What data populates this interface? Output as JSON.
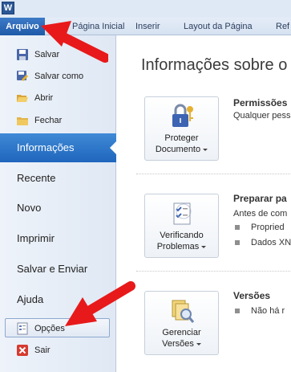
{
  "app": {
    "icon_letter": "W"
  },
  "ribbon": {
    "file_tab": "Arquivo",
    "tabs": [
      "Página Inicial",
      "Inserir",
      "Layout da Página",
      "Ref"
    ]
  },
  "backstage": {
    "commands_top": [
      {
        "label": "Salvar",
        "icon": "save-icon"
      },
      {
        "label": "Salvar como",
        "icon": "save-as-icon"
      },
      {
        "label": "Abrir",
        "icon": "open-folder-icon"
      },
      {
        "label": "Fechar",
        "icon": "close-folder-icon"
      }
    ],
    "nav": [
      "Informações",
      "Recente",
      "Novo",
      "Imprimir",
      "Salvar e Enviar",
      "Ajuda"
    ],
    "active_nav": "Informações",
    "commands_bottom": [
      {
        "label": "Opções",
        "icon": "options-icon"
      },
      {
        "label": "Sair",
        "icon": "exit-icon"
      }
    ]
  },
  "info": {
    "heading": "Informações sobre o",
    "sections": [
      {
        "button_line1": "Proteger",
        "button_line2": "Documento",
        "icon": "lock-key-icon",
        "title": "Permissões",
        "lines": [
          "Qualquer pess"
        ]
      },
      {
        "button_line1": "Verificando",
        "button_line2": "Problemas",
        "icon": "checklist-icon",
        "title": "Preparar pa",
        "lines": [
          "Antes de com"
        ],
        "bullets": [
          "Propried",
          "Dados XN"
        ]
      },
      {
        "button_line1": "Gerenciar",
        "button_line2": "Versões",
        "icon": "versions-icon",
        "title": "Versões",
        "bullets": [
          "Não há r"
        ]
      }
    ]
  },
  "colors": {
    "accent_blue": "#1f66bd",
    "arrow_red": "#e8191a"
  }
}
